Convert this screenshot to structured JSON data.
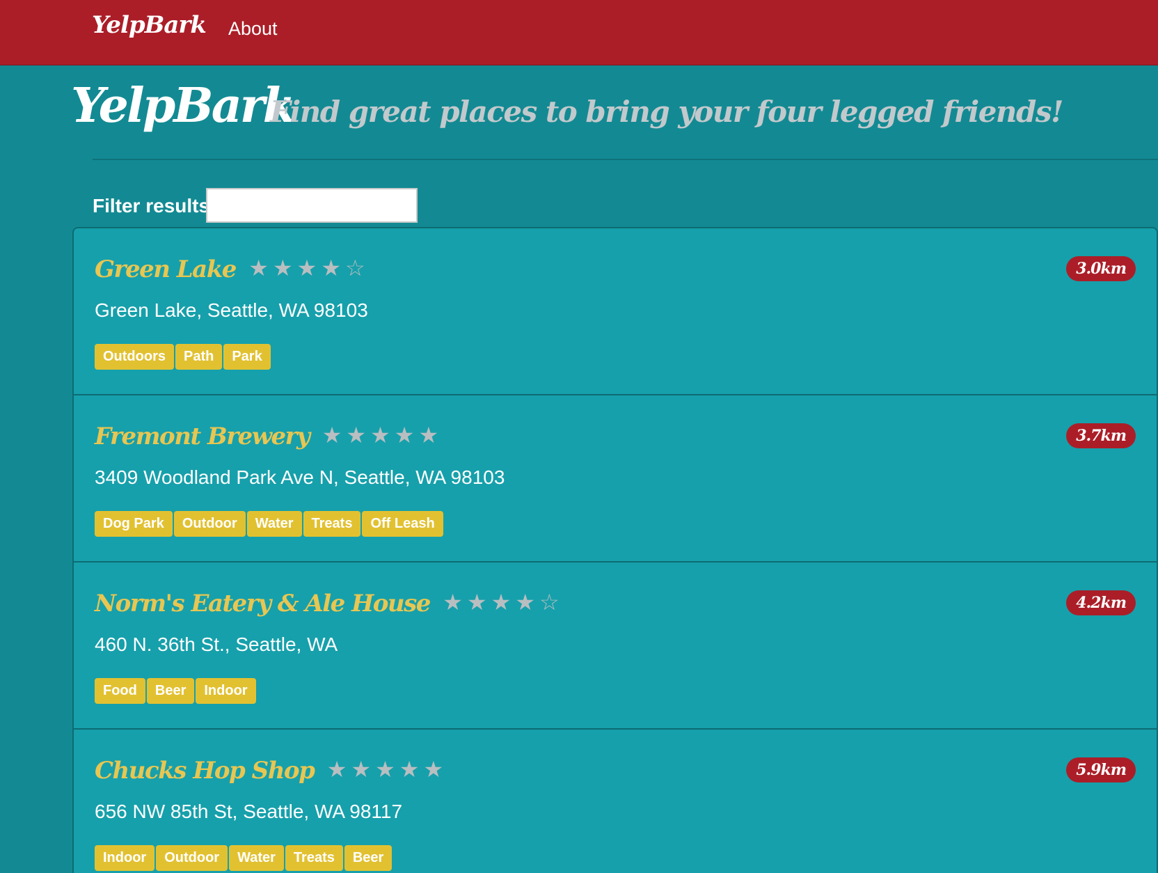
{
  "navbar": {
    "brand": "YelpBark",
    "about": "About"
  },
  "hero": {
    "title": "YelpBark",
    "tagline": "Find great places to bring your four legged friends!"
  },
  "filter": {
    "label": "Filter results",
    "value": "",
    "placeholder": ""
  },
  "star_glyphs": {
    "filled": "★",
    "empty": "☆"
  },
  "places": [
    {
      "name": "Green Lake",
      "rating": 4,
      "max_rating": 5,
      "address": "Green Lake, Seattle, WA 98103",
      "distance": "3.0km",
      "tags": [
        "Outdoors",
        "Path",
        "Park"
      ]
    },
    {
      "name": "Fremont Brewery",
      "rating": 5,
      "max_rating": 5,
      "address": "3409 Woodland Park Ave N, Seattle, WA 98103",
      "distance": "3.7km",
      "tags": [
        "Dog Park",
        "Outdoor",
        "Water",
        "Treats",
        "Off Leash"
      ]
    },
    {
      "name": "Norm's Eatery & Ale House",
      "rating": 4,
      "max_rating": 5,
      "address": "460 N. 36th St., Seattle, WA",
      "distance": "4.2km",
      "tags": [
        "Food",
        "Beer",
        "Indoor"
      ]
    },
    {
      "name": "Chucks Hop Shop",
      "rating": 5,
      "max_rating": 5,
      "address": "656 NW 85th St, Seattle, WA 98117",
      "distance": "5.9km",
      "tags": [
        "Indoor",
        "Outdoor",
        "Water",
        "Treats",
        "Beer"
      ]
    }
  ],
  "colors": {
    "navbar": "#ab1e28",
    "background": "#138a93",
    "list_background": "#16a0ab",
    "place_name": "#e8c652",
    "tag": "#e2c131",
    "distance_badge": "#ab1e28",
    "tagline": "#c2c9cc",
    "star": "#b9bec0"
  }
}
